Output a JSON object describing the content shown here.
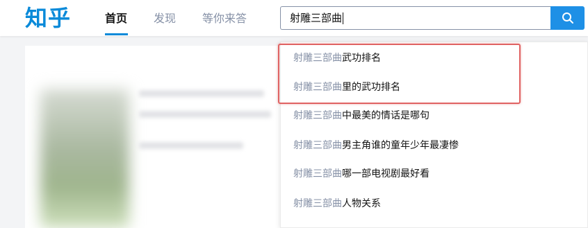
{
  "header": {
    "logo": "知乎",
    "nav": [
      {
        "label": "首页",
        "active": true
      },
      {
        "label": "发现",
        "active": false
      },
      {
        "label": "等你来答",
        "active": false
      }
    ],
    "accent_color": "#0a8ad9"
  },
  "search": {
    "value": "射雕三部曲",
    "button_icon": "search-icon",
    "button_color": "#1e90e6"
  },
  "suggestions": [
    {
      "match": "射雕三部曲",
      "rest": "武功排名"
    },
    {
      "match": "射雕三部曲",
      "rest": "里的武功排名"
    },
    {
      "match": "射雕三部曲",
      "rest": "中最美的情话是哪句"
    },
    {
      "match": "射雕三部曲",
      "rest": "男主角谁的童年少年最凄惨"
    },
    {
      "match": "射雕三部曲",
      "rest": "哪一部电视剧最好看"
    },
    {
      "match": "射雕三部曲",
      "rest": "人物关系"
    }
  ],
  "highlight": {
    "color": "#e06262"
  }
}
